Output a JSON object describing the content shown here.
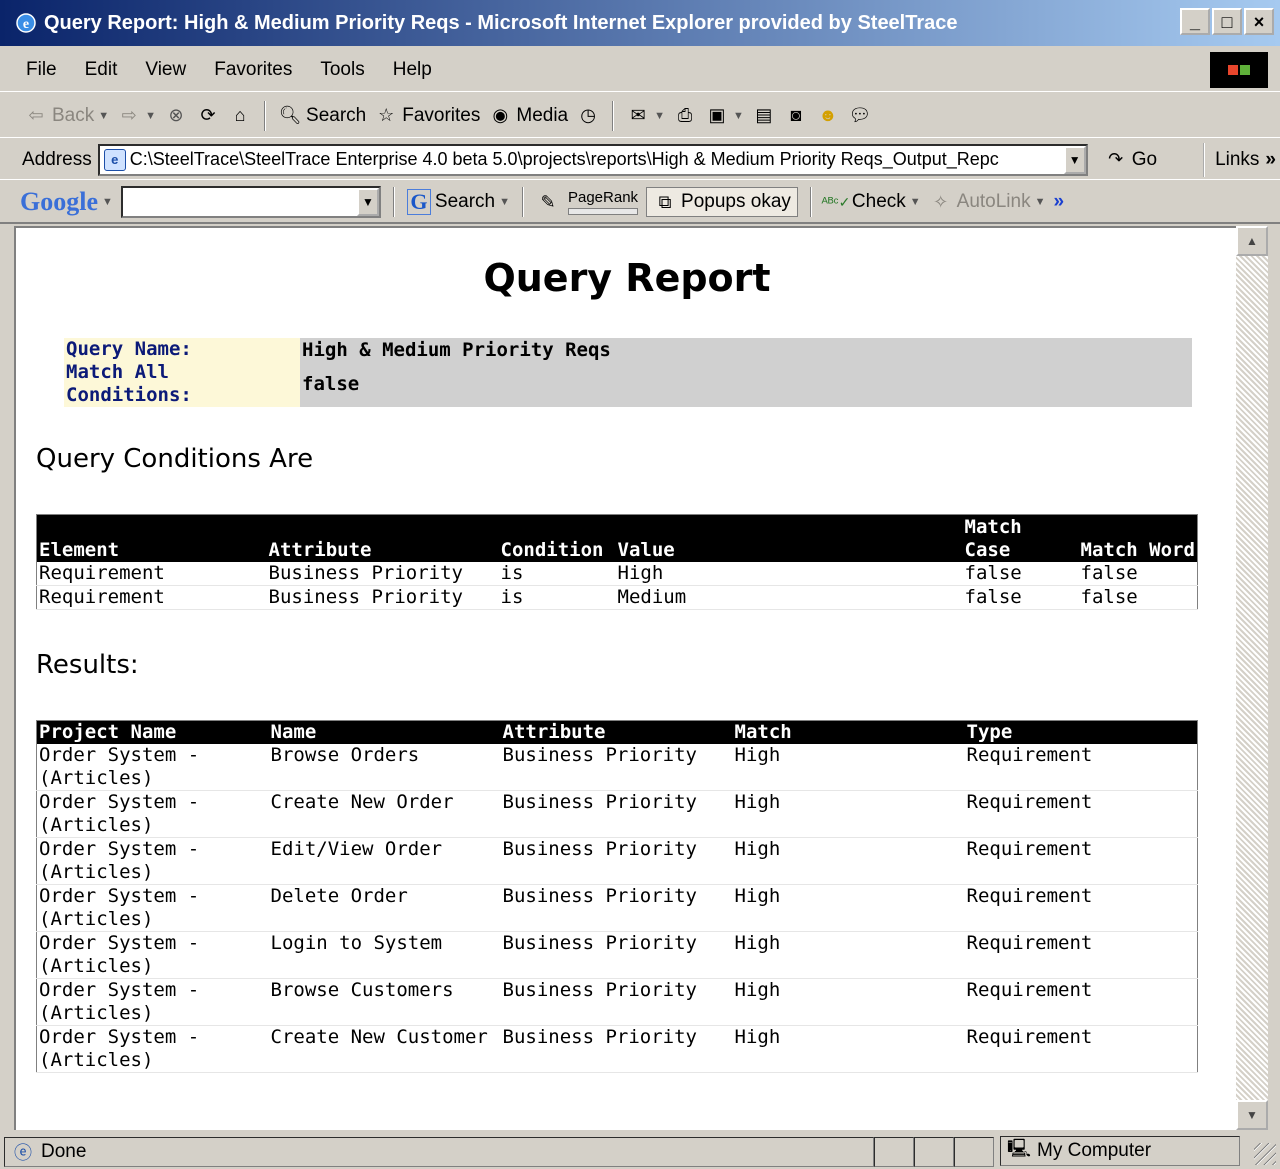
{
  "window": {
    "title": "Query Report: High & Medium Priority Reqs - Microsoft Internet Explorer provided by SteelTrace",
    "minimize": "_",
    "maximize": "□",
    "close": "×"
  },
  "menu": [
    "File",
    "Edit",
    "View",
    "Favorites",
    "Tools",
    "Help"
  ],
  "toolbar": {
    "back": "Back",
    "search": "Search",
    "favorites": "Favorites",
    "media": "Media"
  },
  "address": {
    "label": "Address",
    "value": "C:\\SteelTrace\\SteelTrace Enterprise 4.0 beta 5.0\\projects\\reports\\High & Medium Priority Reqs_Output_Repc",
    "go": "Go",
    "links": "Links"
  },
  "google": {
    "logo": "Google",
    "search": "Search",
    "pagerank": "PageRank",
    "popups": "Popups okay",
    "check": "Check",
    "autolink": "AutoLink"
  },
  "report": {
    "title": "Query Report",
    "query_name_label": "Query Name:",
    "query_name": "High & Medium Priority Reqs",
    "match_all_label": "Match All Conditions:",
    "match_all": "false",
    "conditions_heading": "Query Conditions Are",
    "results_heading": "Results:"
  },
  "conditions": {
    "headers": [
      "Element",
      "Attribute",
      "Condition",
      "Value",
      "Match Case",
      "Match Word"
    ],
    "rows": [
      [
        "Requirement",
        "Business Priority",
        "is",
        "High",
        "false",
        "false"
      ],
      [
        "Requirement",
        "Business Priority",
        "is",
        "Medium",
        "false",
        "false"
      ]
    ]
  },
  "results": {
    "headers": [
      "Project Name",
      "Name",
      "Attribute",
      "Match",
      "Type"
    ],
    "rows": [
      [
        "Order System - (Articles)",
        "Browse Orders",
        "Business Priority",
        "High",
        "Requirement"
      ],
      [
        "Order System - (Articles)",
        "Create New Order",
        "Business Priority",
        "High",
        "Requirement"
      ],
      [
        "Order System - (Articles)",
        "Edit/View Order",
        "Business Priority",
        "High",
        "Requirement"
      ],
      [
        "Order System - (Articles)",
        "Delete Order",
        "Business Priority",
        "High",
        "Requirement"
      ],
      [
        "Order System - (Articles)",
        "Login to System",
        "Business Priority",
        "High",
        "Requirement"
      ],
      [
        "Order System - (Articles)",
        "Browse Customers",
        "Business Priority",
        "High",
        "Requirement"
      ],
      [
        "Order System - (Articles)",
        "Create New Customer",
        "Business Priority",
        "High",
        "Requirement"
      ]
    ]
  },
  "status": {
    "text": "Done",
    "zone": "My Computer"
  }
}
